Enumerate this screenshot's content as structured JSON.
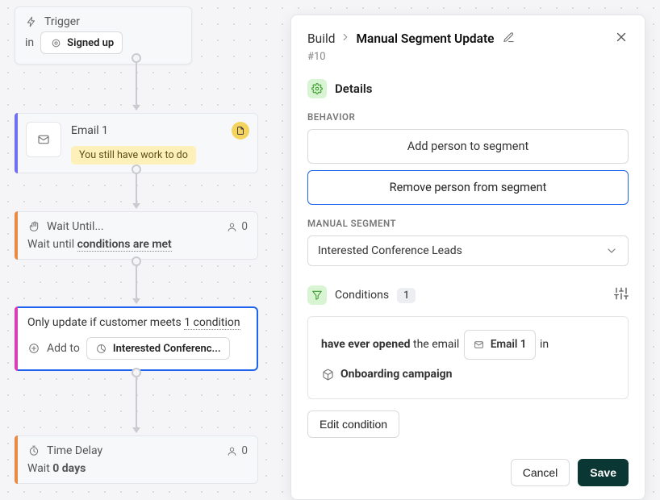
{
  "flow": {
    "trigger": {
      "label": "Trigger",
      "in": "in",
      "event": "Signed up"
    },
    "email": {
      "title": "Email 1",
      "subject": "You still have work to do"
    },
    "wait_until": {
      "label": "Wait Until...",
      "people_count": "0",
      "pre": "Wait until ",
      "cond": "conditions are met"
    },
    "segment_update": {
      "line1_pre": "Only update if customer meets ",
      "line1_link": "1 condition",
      "add_to": "Add to",
      "segment_name": "Interested Conferenc..."
    },
    "delay": {
      "label": "Time Delay",
      "people_count": "0",
      "pre": "Wait ",
      "value": "0 days"
    }
  },
  "panel": {
    "breadcrumb_root": "Build",
    "title": "Manual Segment Update",
    "sub_id": "#10",
    "details_label": "Details",
    "behavior_label": "BEHAVIOR",
    "behavior_options": {
      "add": "Add person to segment",
      "remove": "Remove person from segment"
    },
    "manual_segment_label": "MANUAL SEGMENT",
    "manual_segment_value": "Interested Conference Leads",
    "conditions_label": "Conditions",
    "conditions_count": "1",
    "condition": {
      "pre_bold": "have ever opened",
      "mid": " the email ",
      "chip_label": "Email 1",
      "post": " in",
      "campaign": "Onboarding campaign"
    },
    "edit_condition": "Edit condition",
    "cancel": "Cancel",
    "save": "Save"
  }
}
